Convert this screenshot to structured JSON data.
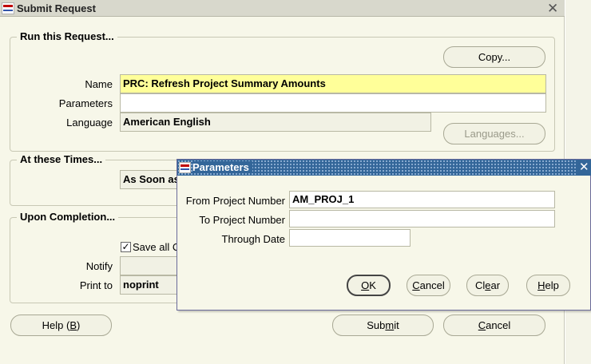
{
  "window": {
    "title": "Submit Request",
    "close_icon": "close-icon"
  },
  "run_request": {
    "group_title": "Run this Request...",
    "copy_button": "Copy...",
    "name_label": "Name",
    "name_value": "PRC: Refresh Project Summary Amounts",
    "parameters_label": "Parameters",
    "parameters_value": "",
    "language_label": "Language",
    "language_value": "American English",
    "languages_button": "Languages..."
  },
  "at_times": {
    "group_title": "At these Times...",
    "run_value": "As Soon as"
  },
  "upon_completion": {
    "group_title": "Upon Completion...",
    "save_all_label": "Save all C",
    "save_all_checked": true,
    "notify_label": "Notify",
    "notify_value": "",
    "print_to_label": "Print to",
    "print_to_value": "noprint"
  },
  "footer": {
    "help_button": "Help (B)",
    "submit_button": "Submit",
    "cancel_button": "Cancel"
  },
  "parameters_dialog": {
    "title": "Parameters",
    "from_project_label": "From Project Number",
    "from_project_value": "AM_PROJ_1",
    "to_project_label": "To Project Number",
    "to_project_value": "",
    "through_date_label": "Through Date",
    "through_date_value": "",
    "ok_button": "OK",
    "cancel_button": "Cancel",
    "clear_button": "Clear",
    "help_button": "Help"
  },
  "colors": {
    "window_bg": "#f7f7e9",
    "required_field": "#ffff99",
    "dialog_title": "#336699"
  }
}
